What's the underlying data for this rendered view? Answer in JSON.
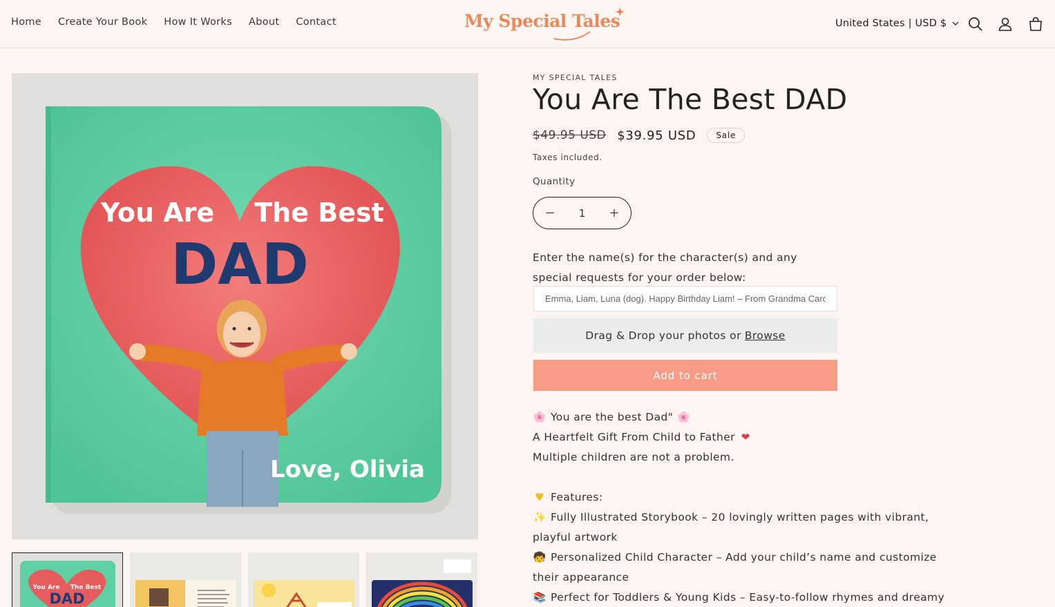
{
  "header": {
    "nav": [
      "Home",
      "Create Your Book",
      "How It Works",
      "About",
      "Contact"
    ],
    "logo": "My Special Tales",
    "currency": "United States | USD $"
  },
  "gallery": {
    "cover_line1": "You Are",
    "cover_line2": "The Best",
    "cover_big": "DAD",
    "cover_sign": "Love, Olivia",
    "thumb_line1": "You Are",
    "thumb_line2": "The Best",
    "thumb_big": "DAD"
  },
  "product": {
    "vendor": "MY SPECIAL TALES",
    "title": "You Are The Best DAD",
    "price_old": "$49.95 USD",
    "price_new": "$39.95 USD",
    "sale_badge": "Sale",
    "tax_note": "Taxes included.",
    "quantity_label": "Quantity",
    "quantity_value": "1",
    "request_label": "Enter the name(s) for the character(s) and any special requests for your order below:",
    "request_placeholder": "Emma, Liam, Luna (dog). Happy Birthday Liam! – From Grandma Carol",
    "upload_text": "Drag & Drop your photos or",
    "upload_browse": "Browse",
    "add_to_cart": "Add to cart"
  },
  "description": {
    "line1": "You are the best Dad\"",
    "line2": "A Heartfelt Gift From Child to Father",
    "line3": "Multiple children are not a problem.",
    "features_heading": "Features:",
    "feature1_a": "Fully Illustrated Storybook – 20 lovingly written pages with vibrant,",
    "feature1_b": "playful artwork",
    "feature2_a": "Personalized Child Character – Add your child’s name and customize",
    "feature2_b": "their appearance",
    "feature3_a": "Perfect for Toddlers & Young Kids – Easy-to-follow rhymes and dreamy"
  },
  "icons": [
    "search-icon",
    "account-icon",
    "cart-icon",
    "chevron-down-icon",
    "minus-icon",
    "plus-icon"
  ],
  "colors": {
    "accent": "#ea8a5c",
    "cart_button": "#f99c87",
    "background": "#fdf5f1"
  }
}
